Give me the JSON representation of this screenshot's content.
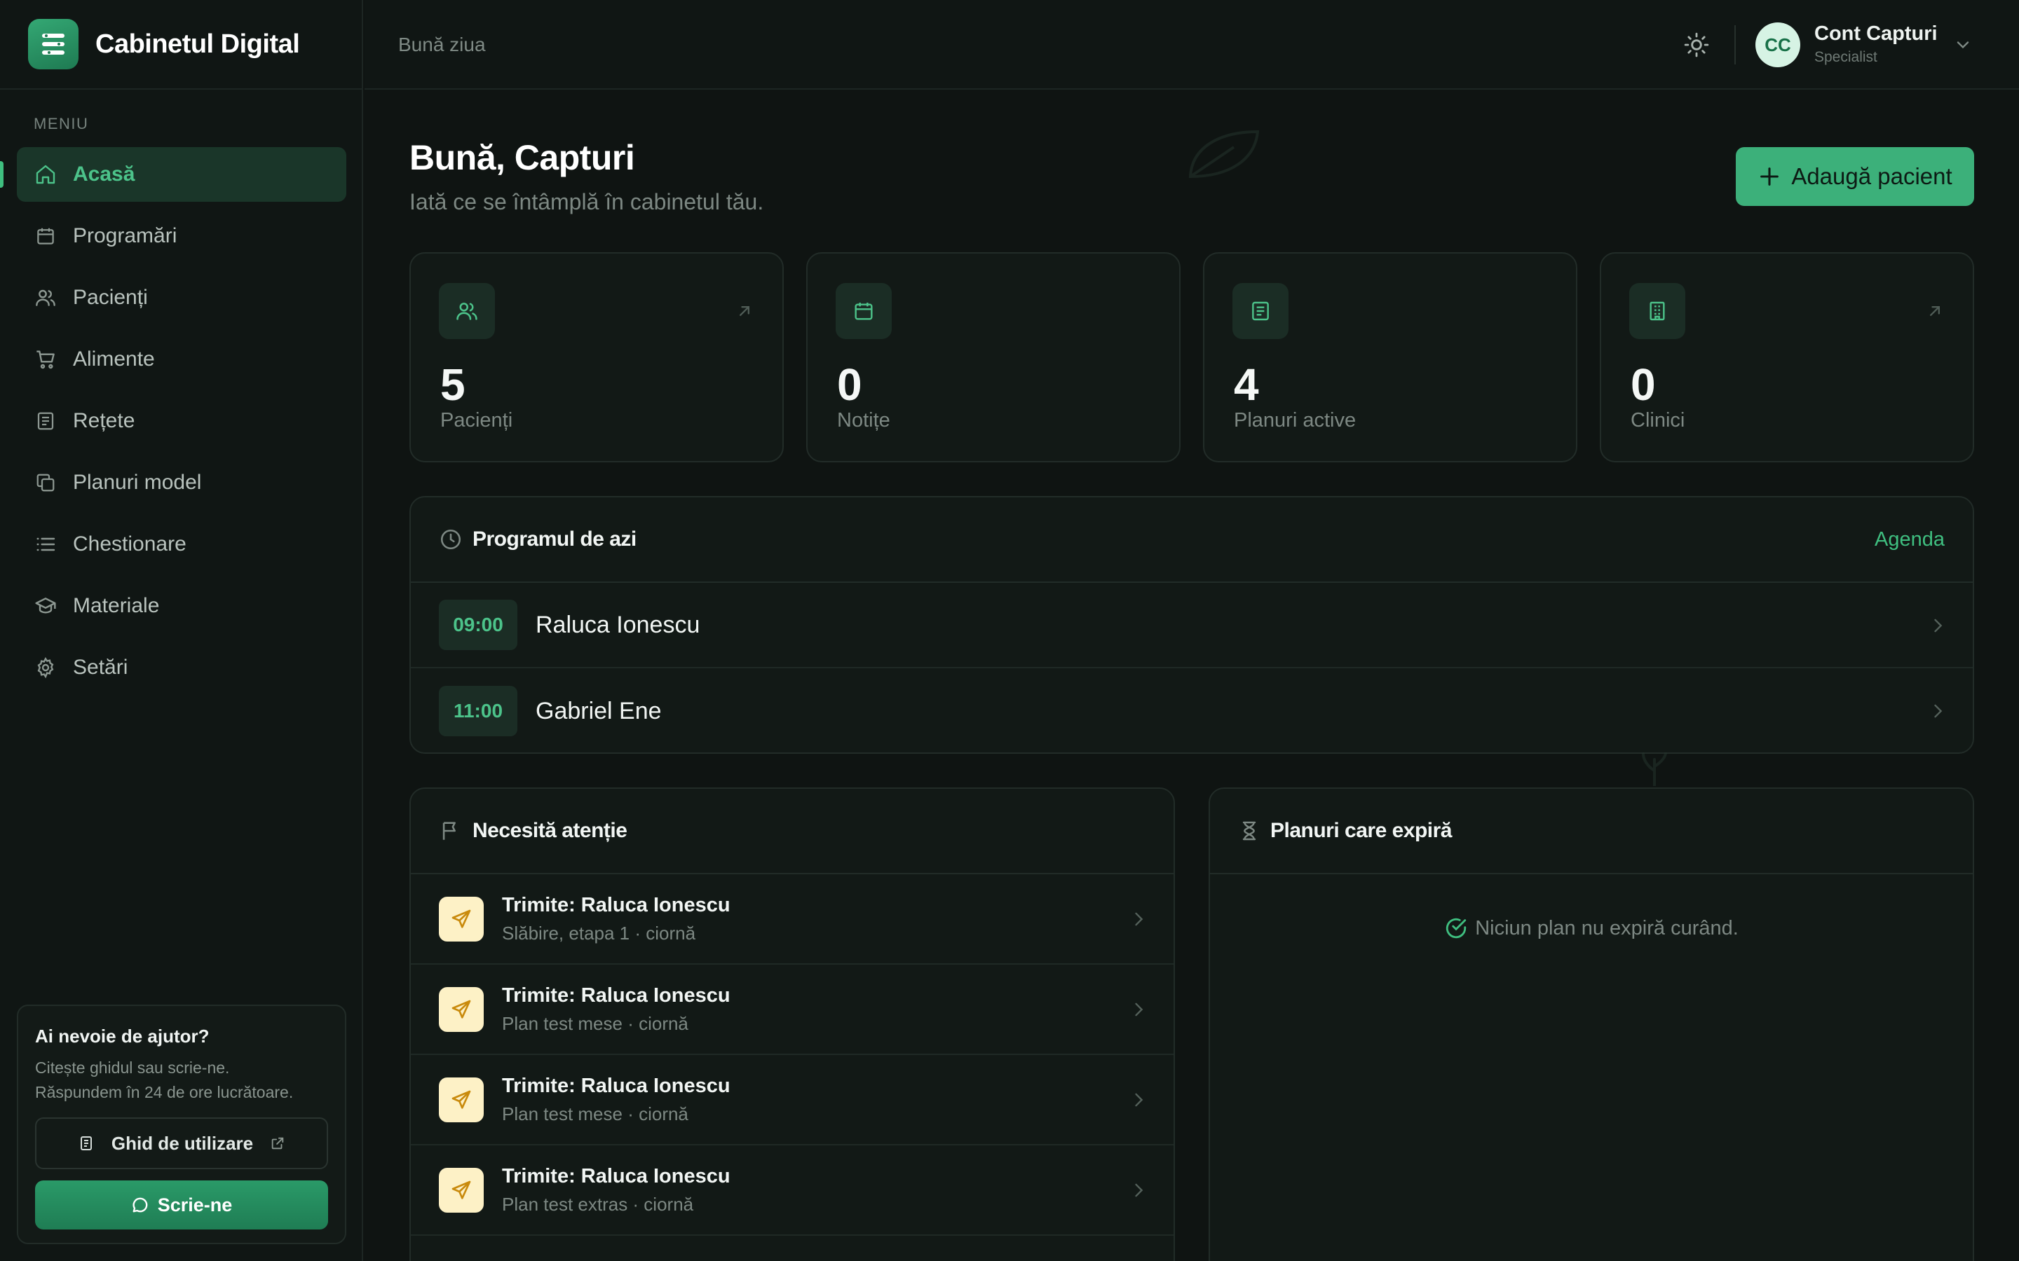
{
  "app": {
    "name": "Cabinetul Digital"
  },
  "sidebar": {
    "menu_label": "MENIU",
    "items": [
      {
        "label": "Acasă",
        "icon": "home-icon",
        "active": true
      },
      {
        "label": "Programări",
        "icon": "calendar-icon"
      },
      {
        "label": "Pacienți",
        "icon": "users-icon"
      },
      {
        "label": "Alimente",
        "icon": "cart-icon"
      },
      {
        "label": "Rețete",
        "icon": "recipe-book-icon"
      },
      {
        "label": "Planuri model",
        "icon": "copy-icon"
      },
      {
        "label": "Chestionare",
        "icon": "list-icon"
      },
      {
        "label": "Materiale",
        "icon": "graduation-cap-icon"
      },
      {
        "label": "Setări",
        "icon": "gear-icon"
      }
    ],
    "help": {
      "title": "Ai nevoie de ajutor?",
      "text_line1": "Citește ghidul sau scrie-ne.",
      "text_line2": "Răspundem în 24 de ore lucrătoare.",
      "guide_label": "Ghid de utilizare",
      "write_label": "Scrie-ne"
    }
  },
  "header": {
    "greeting": "Bună ziua",
    "account": {
      "initials": "CC",
      "name": "Cont Capturi",
      "role": "Specialist"
    }
  },
  "main": {
    "title": "Bună, Capturi",
    "subtitle": "Iată ce se întâmplă în cabinetul tău.",
    "add_patient_label": "Adaugă pacient",
    "stats": [
      {
        "value": "5",
        "label": "Pacienți",
        "icon": "users-icon",
        "has_link": true
      },
      {
        "value": "0",
        "label": "Notițe",
        "icon": "calendar-icon",
        "has_link": false
      },
      {
        "value": "4",
        "label": "Planuri active",
        "icon": "document-icon",
        "has_link": false
      },
      {
        "value": "0",
        "label": "Clinici",
        "icon": "building-icon",
        "has_link": true
      }
    ],
    "schedule": {
      "title": "Programul de azi",
      "link": "Agenda",
      "items": [
        {
          "time": "09:00",
          "name": "Raluca Ionescu"
        },
        {
          "time": "11:00",
          "name": "Gabriel Ene"
        }
      ]
    },
    "attention": {
      "title": "Necesită atenție",
      "items": [
        {
          "title": "Trimite: Raluca Ionescu",
          "sub": "Slăbire, etapa 1 · ciornă"
        },
        {
          "title": "Trimite: Raluca Ionescu",
          "sub": "Plan test mese · ciornă"
        },
        {
          "title": "Trimite: Raluca Ionescu",
          "sub": "Plan test mese · ciornă"
        },
        {
          "title": "Trimite: Raluca Ionescu",
          "sub": "Plan test extras · ciornă"
        }
      ]
    },
    "expiring": {
      "title": "Planuri care expiră",
      "empty": "Niciun plan nu expiră curând."
    }
  },
  "colors": {
    "accent": "#3cb07a",
    "background": "#0f1412",
    "card": "#121916",
    "warning_bg": "#fdf1c6"
  }
}
